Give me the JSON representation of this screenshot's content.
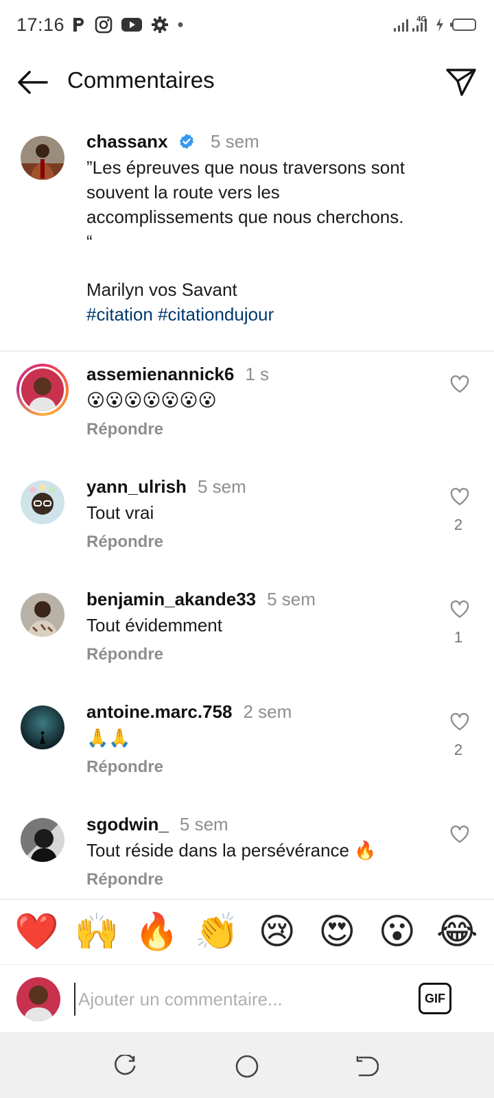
{
  "status_bar": {
    "time": "17:16",
    "network": "4G"
  },
  "header": {
    "title": "Commentaires"
  },
  "post": {
    "username": "chassanx",
    "time": "5 sem",
    "caption_lines": [
      "”Les épreuves que nous traversons sont",
      "souvent la route vers les",
      "accomplissements que nous cherchons.",
      "“",
      "",
      "Marilyn vos Savant"
    ],
    "hashtags": "#citation #citationdujour"
  },
  "comments": [
    {
      "username": "assemienannick6",
      "time": "1 s",
      "text": "😮😮😮😮😮😮😮",
      "reply": "Répondre",
      "likes": ""
    },
    {
      "username": "yann_ulrish",
      "time": "5 sem",
      "text": "Tout vrai",
      "reply": "Répondre",
      "likes": "2"
    },
    {
      "username": "benjamin_akande33",
      "time": "5 sem",
      "text": "Tout évidemment",
      "reply": "Répondre",
      "likes": "1"
    },
    {
      "username": "antoine.marc.758",
      "time": "2 sem",
      "text": "🙏🙏",
      "reply": "Répondre",
      "likes": "2"
    },
    {
      "username": "sgodwin_",
      "time": "5 sem",
      "text": "Tout réside dans la persévérance 🔥",
      "reply": "Répondre",
      "likes": ""
    }
  ],
  "reactions": [
    "❤️",
    "🙌",
    "🔥",
    "👏",
    "😢",
    "😍",
    "😮",
    "😂"
  ],
  "compose": {
    "placeholder": "Ajouter un commentaire...",
    "gif_label": "GIF"
  },
  "colors": {
    "hashtag": "#00376b",
    "verified": "#3897f0",
    "muted": "#8e8e8e"
  },
  "icons": {
    "back": "arrow-left-icon",
    "share": "paper-plane-icon",
    "like": "heart-outline-icon",
    "verified": "verified-badge-icon"
  }
}
